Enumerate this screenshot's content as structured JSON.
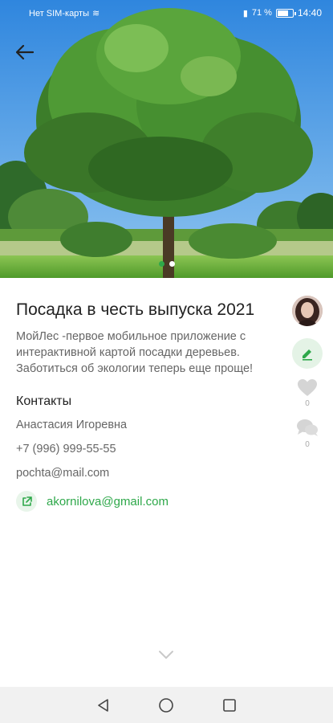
{
  "status_bar": {
    "carrier": "Нет SIM-карты",
    "battery_percent": "71 %",
    "battery_level": 0.71,
    "time": "14:40"
  },
  "gallery": {
    "image_count": 2,
    "active_index": 0
  },
  "post": {
    "title": "Посадка в честь выпуска 2021",
    "description": "МойЛес -первое мобильное приложение с интерактивной картой посадки деревьев. Заботиться об экологии теперь еще проще!"
  },
  "contacts": {
    "heading": "Контакты",
    "name": "Анастасия Игоревна",
    "phone": "+7 (996) 999-55-55",
    "email": "pochta@mail.com",
    "link": "akornilova@gmail.com"
  },
  "actions": {
    "likes": "0",
    "comments": "0"
  },
  "colors": {
    "accent": "#2ea84a",
    "accent_light": "#e4f3e6",
    "sky": "#4a9ee8",
    "grass": "#6fb63d"
  },
  "icons": {
    "back": "arrow-left-icon",
    "edit": "pencil-icon",
    "like": "heart-icon",
    "comment": "chat-bubble-icon",
    "link": "external-link-icon",
    "expand": "chevron-down-icon"
  }
}
